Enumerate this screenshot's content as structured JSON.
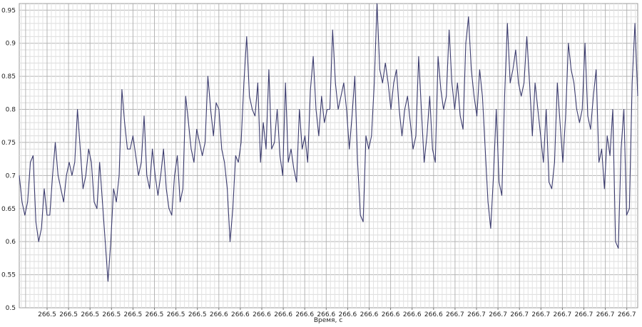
{
  "chart_data": {
    "type": "line",
    "title": "",
    "xlabel": "Время, с",
    "ylabel": "",
    "ylim": [
      0.5,
      0.96
    ],
    "yticks": [
      "0.5",
      "0.55",
      "0.6",
      "0.65",
      "0.7",
      "0.75",
      "0.8",
      "0.85",
      "0.9",
      "0.95"
    ],
    "ytick_values": [
      0.5,
      0.55,
      0.6,
      0.65,
      0.7,
      0.75,
      0.8,
      0.85,
      0.9,
      0.95
    ],
    "xticks": [
      "266.5",
      "266.5",
      "266.5",
      "266.5",
      "266.5",
      "266.5",
      "266.5",
      "266.5",
      "266.6",
      "266.6",
      "266.6",
      "266.6",
      "266.6",
      "266.6",
      "266.6",
      "266.6",
      "266.6",
      "266.6",
      "266.6",
      "266.7",
      "266.7",
      "266.7",
      "266.7",
      "266.7",
      "266.7",
      "266.7",
      "266.7",
      "266.7"
    ],
    "grid": true,
    "line_color": "#3b3b6e",
    "series": [
      {
        "values": [
          0.7,
          0.66,
          0.64,
          0.66,
          0.72,
          0.73,
          0.63,
          0.6,
          0.62,
          0.68,
          0.64,
          0.64,
          0.7,
          0.75,
          0.7,
          0.68,
          0.66,
          0.7,
          0.72,
          0.7,
          0.72,
          0.8,
          0.74,
          0.68,
          0.7,
          0.74,
          0.72,
          0.66,
          0.65,
          0.72,
          0.66,
          0.6,
          0.54,
          0.6,
          0.68,
          0.66,
          0.7,
          0.83,
          0.78,
          0.74,
          0.74,
          0.76,
          0.73,
          0.7,
          0.72,
          0.79,
          0.7,
          0.68,
          0.74,
          0.7,
          0.67,
          0.7,
          0.74,
          0.68,
          0.65,
          0.64,
          0.7,
          0.73,
          0.66,
          0.68,
          0.82,
          0.78,
          0.74,
          0.72,
          0.77,
          0.75,
          0.73,
          0.75,
          0.85,
          0.8,
          0.76,
          0.81,
          0.8,
          0.74,
          0.72,
          0.68,
          0.6,
          0.65,
          0.73,
          0.72,
          0.75,
          0.84,
          0.91,
          0.82,
          0.8,
          0.79,
          0.84,
          0.72,
          0.78,
          0.74,
          0.86,
          0.74,
          0.75,
          0.8,
          0.73,
          0.7,
          0.84,
          0.72,
          0.74,
          0.71,
          0.69,
          0.8,
          0.74,
          0.76,
          0.72,
          0.83,
          0.88,
          0.8,
          0.76,
          0.82,
          0.78,
          0.8,
          0.8,
          0.92,
          0.84,
          0.8,
          0.82,
          0.84,
          0.8,
          0.74,
          0.79,
          0.85,
          0.72,
          0.64,
          0.63,
          0.76,
          0.74,
          0.76,
          0.84,
          0.96,
          0.86,
          0.84,
          0.87,
          0.84,
          0.8,
          0.84,
          0.86,
          0.8,
          0.76,
          0.8,
          0.82,
          0.78,
          0.74,
          0.76,
          0.88,
          0.8,
          0.72,
          0.76,
          0.82,
          0.74,
          0.72,
          0.88,
          0.83,
          0.8,
          0.82,
          0.92,
          0.84,
          0.8,
          0.84,
          0.79,
          0.77,
          0.9,
          0.94,
          0.86,
          0.82,
          0.79,
          0.86,
          0.82,
          0.74,
          0.66,
          0.62,
          0.7,
          0.8,
          0.69,
          0.67,
          0.82,
          0.93,
          0.84,
          0.86,
          0.89,
          0.84,
          0.82,
          0.84,
          0.91,
          0.84,
          0.76,
          0.84,
          0.8,
          0.76,
          0.72,
          0.8,
          0.69,
          0.68,
          0.72,
          0.84,
          0.78,
          0.72,
          0.79,
          0.9,
          0.86,
          0.84,
          0.8,
          0.78,
          0.8,
          0.9,
          0.79,
          0.77,
          0.82,
          0.86,
          0.72,
          0.74,
          0.68,
          0.76,
          0.73,
          0.8,
          0.6,
          0.59,
          0.74,
          0.8,
          0.64,
          0.65,
          0.84,
          0.93,
          0.82
        ]
      }
    ]
  }
}
